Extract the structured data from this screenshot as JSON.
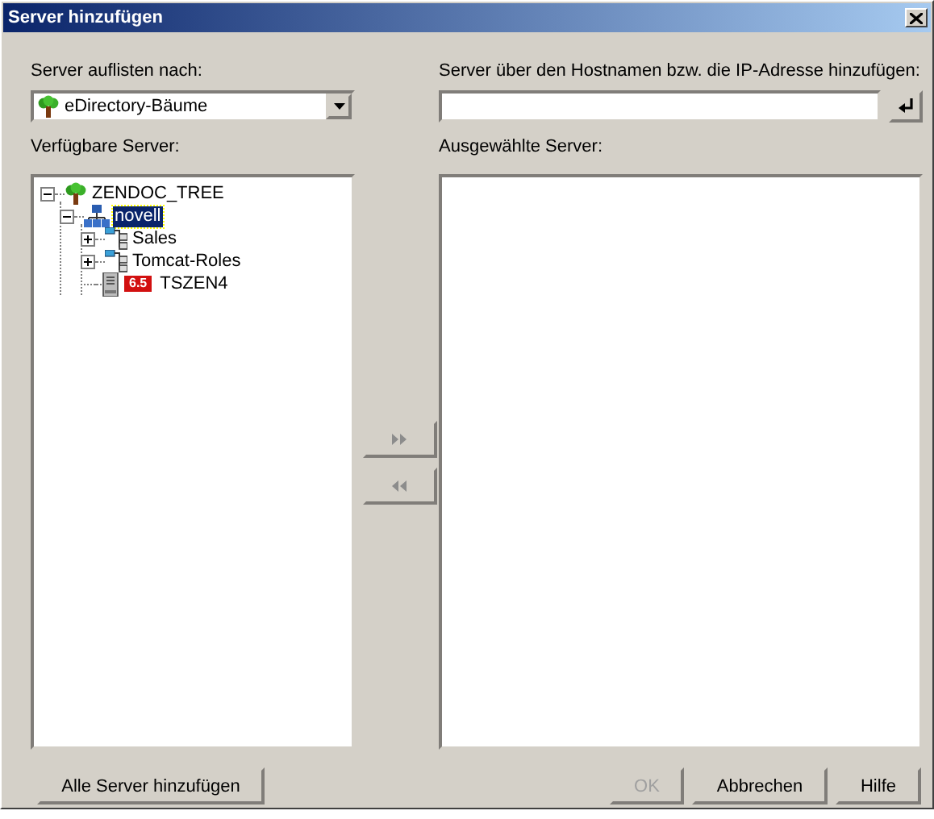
{
  "window": {
    "title": "Server hinzufügen"
  },
  "list_by": {
    "label": "Server auflisten nach:",
    "value": "eDirectory-Bäume"
  },
  "host": {
    "label": "Server über den Hostnamen bzw. die IP-Adresse hinzufügen:"
  },
  "available": {
    "label": "Verfügbare Server:",
    "tree": [
      {
        "label": "ZENDOC_TREE",
        "kind": "tree",
        "expanded": true,
        "selected": false,
        "children": [
          {
            "label": "novell",
            "kind": "organization",
            "expanded": true,
            "selected": true,
            "children": [
              {
                "label": "Sales",
                "kind": "container",
                "expanded": false,
                "selected": false
              },
              {
                "label": "Tomcat-Roles",
                "kind": "container",
                "expanded": false,
                "selected": false
              },
              {
                "label": "TSZEN4",
                "kind": "server",
                "selected": false,
                "badge": "6.5"
              }
            ]
          }
        ]
      }
    ]
  },
  "move_buttons": [
    {
      "kind": "add",
      "disabled": true
    },
    {
      "kind": "remove",
      "disabled": true
    }
  ],
  "selected_servers": {
    "label": "Ausgewählte Server:"
  },
  "buttons": [
    {
      "label": "Alle Server hinzufügen",
      "disabled": false
    },
    {
      "label": "OK",
      "disabled": true
    },
    {
      "label": "Abbrechen",
      "disabled": false
    },
    {
      "label": "Hilfe",
      "disabled": false
    }
  ]
}
